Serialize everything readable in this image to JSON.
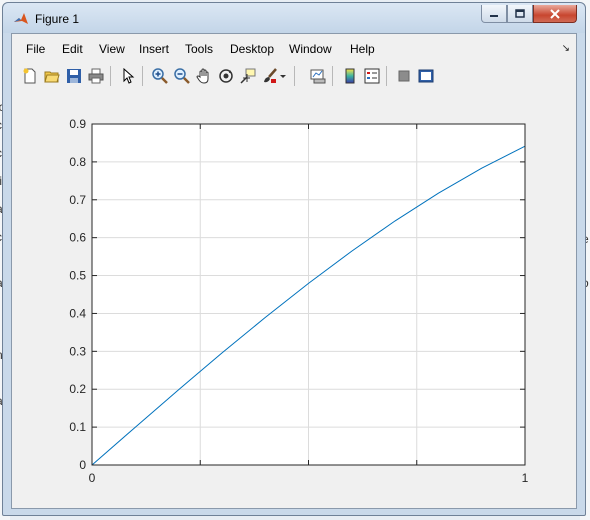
{
  "window": {
    "title": "Figure 1"
  },
  "menu": [
    "File",
    "Edit",
    "View",
    "Insert",
    "Tools",
    "Desktop",
    "Window",
    "Help"
  ],
  "menu_overflow_icon": "dock-arrow-icon",
  "toolbar": [
    "new-figure-icon",
    "open-file-icon",
    "save-figure-icon",
    "print-figure-icon",
    "edit-plot-icon",
    "zoom-in-icon",
    "zoom-out-icon",
    "pan-icon",
    "rotate-3d-icon",
    "data-cursor-icon",
    "brush-icon",
    "brush-dropdown-icon",
    "link-plot-icon",
    "insert-colorbar-icon",
    "insert-legend-icon",
    "hide-plot-tools-icon",
    "show-plot-tools-icon"
  ],
  "colors": {
    "line": "#0072bd",
    "grid": "#dcdcdc",
    "axes_bg": "#ffffff",
    "figure_bg": "#f0f0f0"
  },
  "chart_data": {
    "type": "line",
    "title": "",
    "xlabel": "",
    "ylabel": "",
    "xlim": [
      0,
      1
    ],
    "ylim": [
      0,
      0.9
    ],
    "xticks": [
      "0",
      "1"
    ],
    "yticks": [
      "0",
      "0.1",
      "0.2",
      "0.3",
      "0.4",
      "0.5",
      "0.6",
      "0.7",
      "0.8",
      "0.9"
    ],
    "grid": true,
    "series": [
      {
        "x": [
          0,
          0.1,
          0.2,
          0.3,
          0.4,
          0.5,
          0.6,
          0.7,
          0.8,
          0.9,
          1.0
        ],
        "y": [
          0,
          0.0998,
          0.1987,
          0.2955,
          0.3894,
          0.4794,
          0.5646,
          0.6442,
          0.7174,
          0.7833,
          0.8415
        ]
      }
    ]
  }
}
